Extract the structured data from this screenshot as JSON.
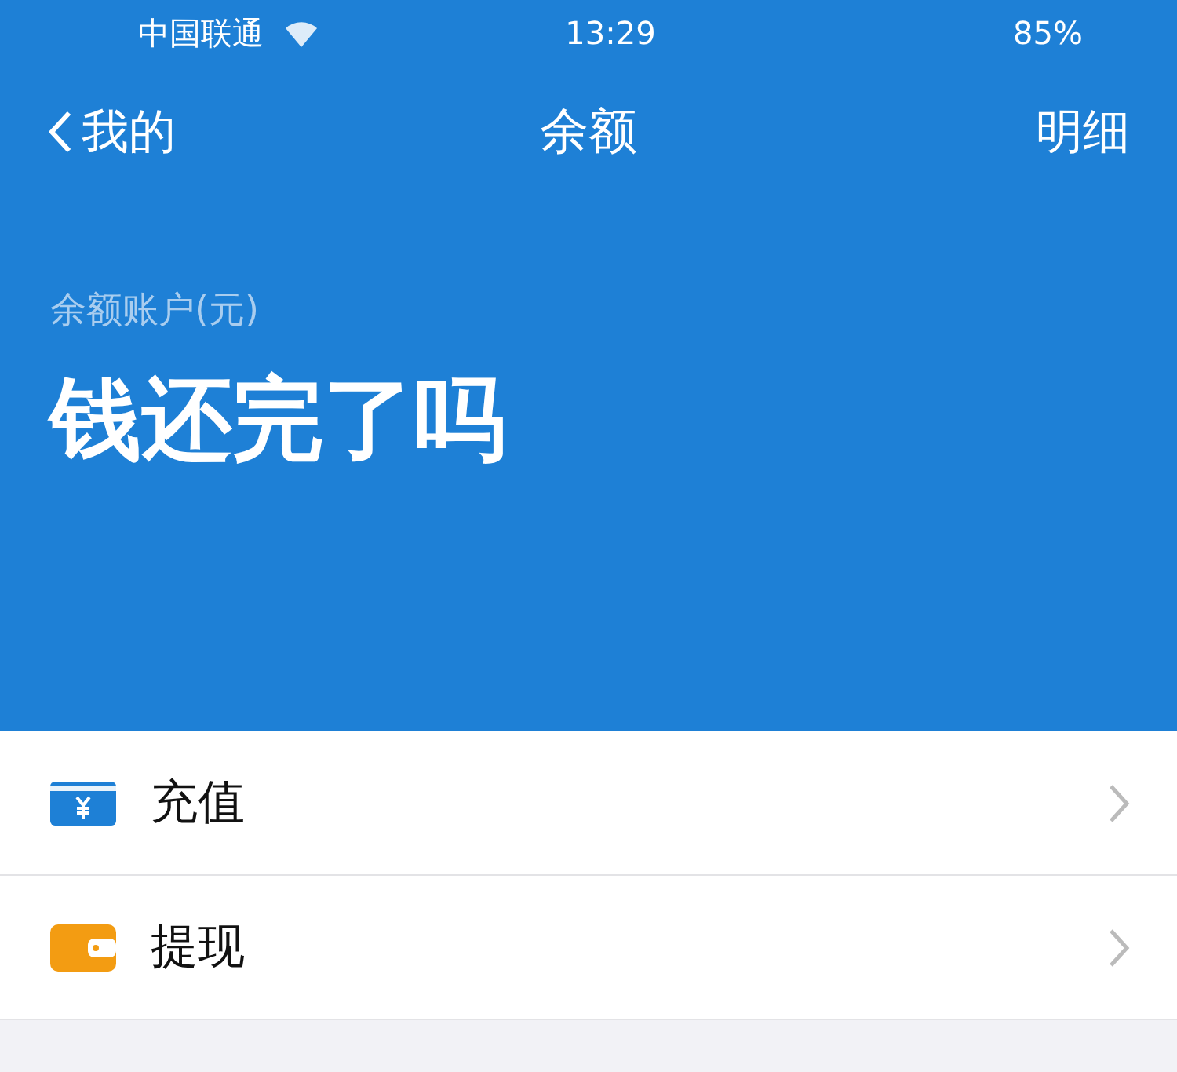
{
  "status_bar": {
    "carrier": "中国联通",
    "time": "13:29",
    "battery": "85%"
  },
  "nav": {
    "back": "我的",
    "title": "余额",
    "action": "明细"
  },
  "balance": {
    "label": "余额账户(元)",
    "amount": "钱还完了吗"
  },
  "items": [
    {
      "kind": "recharge",
      "label": "充值"
    },
    {
      "kind": "withdraw",
      "label": "提现"
    }
  ]
}
